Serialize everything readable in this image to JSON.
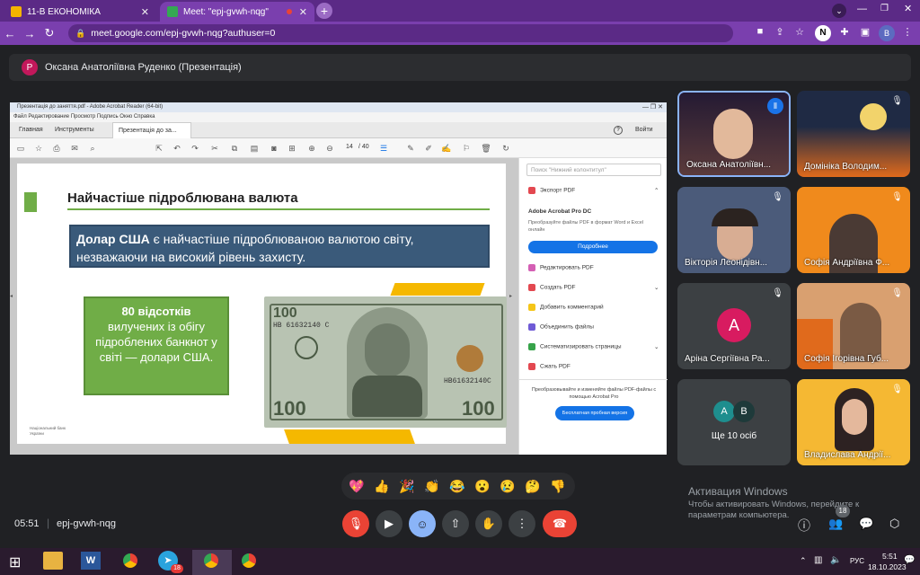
{
  "browser": {
    "tabs": [
      {
        "title": "11-В ЕКОНОМІКА",
        "active": false
      },
      {
        "title": "Meet: \"epj-gvwh-nqg\"",
        "active": true
      }
    ],
    "url": "meet.google.com/epj-gvwh-nqg?authuser=0",
    "profile_initial_n": "N",
    "profile_initial_b": "B"
  },
  "meet": {
    "presenter_initial": "P",
    "presenter_title": "Оксана Анатоліївна Руденко (Презентація)",
    "time": "05:51",
    "meeting_code": "epj-gvwh-nqg",
    "activation_title": "Активация Windows",
    "activation_body": "Чтобы активировать Windows, перейдите к параметрам компьютера.",
    "people_badge": "18",
    "reactions": [
      "💖",
      "👍",
      "🎉",
      "👏",
      "😂",
      "😮",
      "😢",
      "🤔",
      "👎"
    ]
  },
  "participants": [
    {
      "name": "Оксана Анатоліївн...",
      "bg": "#3a2a4a"
    },
    {
      "name": "Домініка Володим...",
      "bg": "#1f2a44"
    },
    {
      "name": "Вікторія Леонідівн...",
      "bg": "#4b5b7a"
    },
    {
      "name": "Софія Андріївна Ф...",
      "bg": "#f08a1c"
    },
    {
      "name": "Аріна Сергіївна Ра...",
      "initial": "A",
      "bg": "#3c4043"
    },
    {
      "name": "Софія Ігорівна Губ...",
      "bg": "#d9a070"
    },
    {
      "name": "Ще 10 осіб",
      "initials": [
        "A",
        "B"
      ],
      "bg": "#3c4043"
    },
    {
      "name": "Владислава Андрії...",
      "bg": "#f5b833"
    }
  ],
  "shared": {
    "reader_title": "Презентація до заняття.pdf - Adobe Acrobat Reader (64-bit)",
    "menu": "Файл   Редактирование   Просмотр   Подпись   Окно   Справка",
    "tabs": [
      "Главная",
      "Инструменты",
      "Презентація до за..."
    ],
    "signin": "Войти",
    "page_num": "14",
    "page_total": "/ 40",
    "search_placeholder": "Поиск \"Нижний колонтитул\"",
    "slide_title": "Найчастіше підроблювана валюта",
    "blue_bold": "Долар США",
    "blue_rest": " є найчастіше підроблюваною валютою світу, незважаючи на високий рівень захисту.",
    "green_bold": "80 відсотків",
    "green_rest": "вилучених із обігу підроблених банкнот у світі — долари США.",
    "bill_serial": "HB 61632140 C",
    "bill_serial2": "HB61632140C",
    "bill_denom": "100",
    "bank_logo": "Національний банк України",
    "pane": {
      "export": "Экспорт PDF",
      "product": "Adobe Acrobat Pro DC",
      "desc": "Преобразуйте файлы PDF в формат Word и Excel онлайн",
      "more_btn": "Подробнее",
      "items": [
        "Редактировать PDF",
        "Создать PDF",
        "Добавить комментарий",
        "Объединить файлы",
        "Систематизировать страницы",
        "Сжать PDF"
      ],
      "promo": "Преобразовывайте и изменяйте файлы PDF-файлы с помощью Acrobat Pro",
      "trial_btn": "Бесплатная пробная версия"
    }
  },
  "taskbar": {
    "lang": "РУС",
    "time": "5:51",
    "date": "18.10.2023",
    "telegram_badge": "18"
  }
}
